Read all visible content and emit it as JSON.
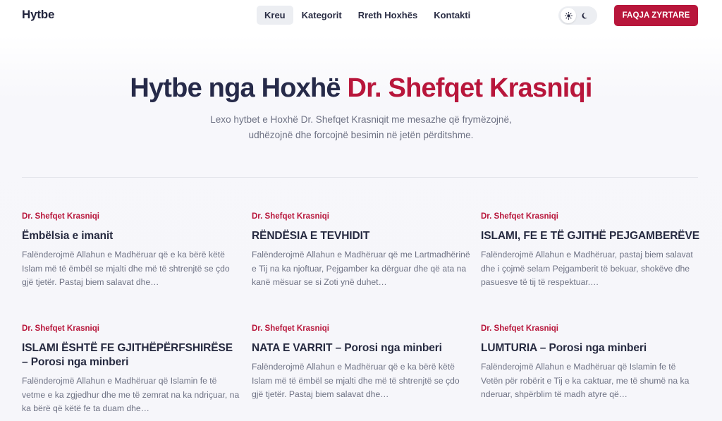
{
  "header": {
    "logo": "Hytbe",
    "nav": [
      {
        "label": "Kreu",
        "active": true
      },
      {
        "label": "Kategorit",
        "active": false
      },
      {
        "label": "Rreth Hoxhës",
        "active": false
      },
      {
        "label": "Kontakti",
        "active": false
      }
    ],
    "theme_toggle": {
      "light_icon": "sun-icon",
      "dark_icon": "moon-icon"
    },
    "cta_label": "FAQJA ZYRTARE"
  },
  "hero": {
    "title_main": "Hytbe nga Hoxhë ",
    "title_accent": "Dr. Shefqet Krasniqi",
    "subtitle_line1": "Lexo hytbet e Hoxhë Dr. Shefqet Krasniqit me mesazhe që frymëzojnë,",
    "subtitle_line2": "udhëzojnë dhe forcojnë besimin në jetën përditshme."
  },
  "colors": {
    "accent": "#b8163b",
    "text": "#262a49",
    "muted": "#6e7284"
  },
  "posts": [
    {
      "author": "Dr. Shefqet Krasniqi",
      "title": "Ëmbëlsia e imanit",
      "excerpt": "Falënderojmë Allahun e Madhëruar që e ka bërë këtë Islam më të ëmbël se mjalti dhe më të shtrenjtë se çdo gjë tjetër. Pastaj biem salavat dhe…"
    },
    {
      "author": "Dr. Shefqet Krasniqi",
      "title": "RËNDËSIA E TEVHIDIT",
      "excerpt": "Falënderojmë Allahun e Madhëruar që me Lartmadhërinë e Tij na ka njoftuar, Pejgamber ka dërguar dhe që ata na kanë mësuar se si Zoti ynë duhet…"
    },
    {
      "author": "Dr. Shefqet Krasniqi",
      "title": "ISLAMI, FE E TË GJITHË PEJGAMBERËVE",
      "excerpt": "Falënderojmë Allahun e Madhëruar, pastaj biem salavat dhe i çojmë selam Pejgamberit të bekuar, shokëve dhe pasuesve të tij të respektuar.…"
    },
    {
      "author": "Dr. Shefqet Krasniqi",
      "title": "ISLAMI ËSHTË FE GJITHËPËRFSHIRËSE – Porosi nga minberi",
      "excerpt": "Falënderojmë Allahun e Madhëruar që Islamin fe të vetme e ka zgjedhur dhe me të zemrat na ka ndriçuar, na ka bërë që këtë fe ta duam dhe…"
    },
    {
      "author": "Dr. Shefqet Krasniqi",
      "title": "NATA E VARRIT – Porosi nga minberi",
      "excerpt": "Falënderojmë Allahun e Madhëruar që e ka bërë këtë Islam më të ëmbël se mjalti dhe më të shtrenjtë se çdo gjë tjetër. Pastaj biem salavat dhe…"
    },
    {
      "author": "Dr. Shefqet Krasniqi",
      "title": "LUMTURIA – Porosi nga minberi",
      "excerpt": "Falënderojmë Allahun e Madhëruar që Islamin fe të Vetën për robërit e Tij e ka caktuar, me të shumë na ka nderuar, shpërblim të madh atyre që…"
    }
  ]
}
